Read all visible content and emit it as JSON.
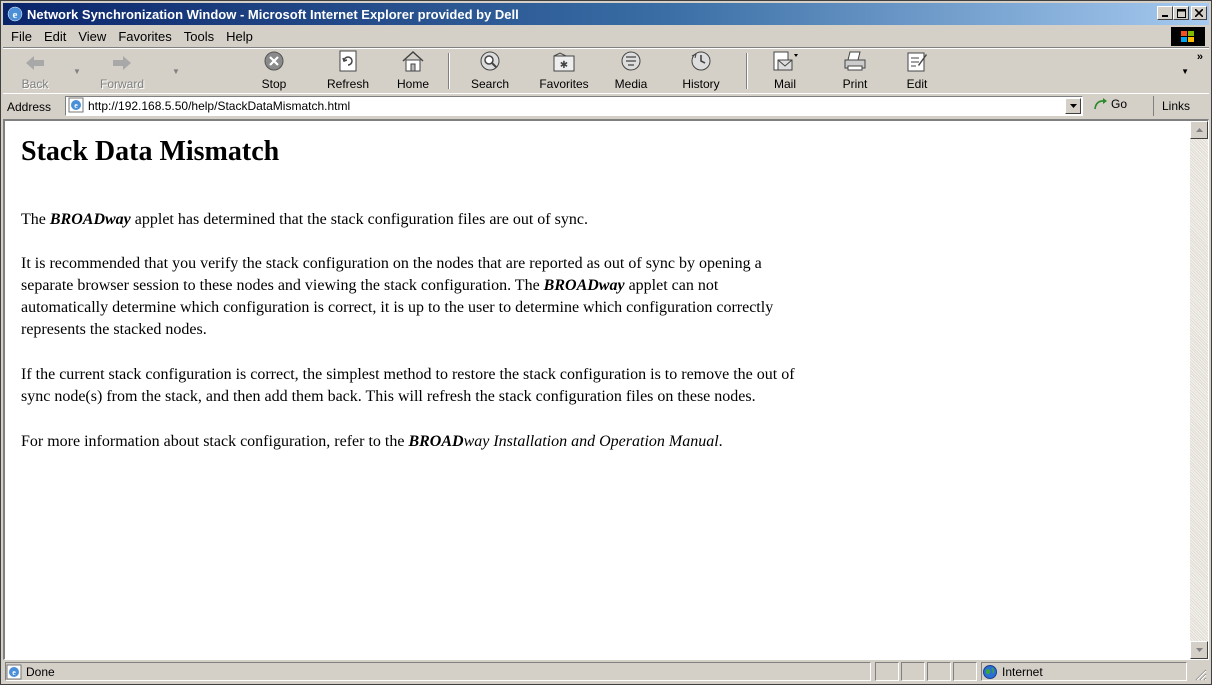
{
  "window": {
    "title": "Network Synchronization Window - Microsoft Internet Explorer provided by Dell"
  },
  "menu": [
    "File",
    "Edit",
    "View",
    "Favorites",
    "Tools",
    "Help"
  ],
  "toolbar": {
    "back": "Back",
    "forward": "Forward",
    "stop": "Stop",
    "refresh": "Refresh",
    "home": "Home",
    "search": "Search",
    "favorites": "Favorites",
    "media": "Media",
    "history": "History",
    "mail": "Mail",
    "print": "Print",
    "edit": "Edit"
  },
  "address": {
    "label": "Address",
    "url": "http://192.168.5.50/help/StackDataMismatch.html",
    "go": "Go",
    "links": "Links"
  },
  "page": {
    "heading": "Stack Data Mismatch",
    "brand": "BROADway",
    "p1_before": "The ",
    "p1_after": " applet has determined that the stack configuration files are out of sync.",
    "p2_line1": "It is recommended that you verify the stack configuration on the nodes that are reported as out of sync by opening a",
    "p2_line2_before": "separate browser session to these nodes and viewing the stack configuration. The ",
    "p2_line2_after": " applet can not",
    "p2_line3": "automatically determine which configuration is correct, it is up to the user to determine which configuration correctly",
    "p2_line4": "represents the stacked nodes.",
    "p3_line1": "If the current stack configuration is correct, the simplest method to restore the stack configuration is to remove the out of",
    "p3_line2": "sync node(s) from the stack, and then add them back. This will refresh the stack configuration files on these nodes.",
    "p4_before": "For more information about stack configuration, refer to the ",
    "p4_manual_brand": "BROAD",
    "p4_manual_rest": "way Installation and Operation Manual",
    "p4_after": "."
  },
  "status": {
    "text": "Done",
    "zone": "Internet"
  }
}
